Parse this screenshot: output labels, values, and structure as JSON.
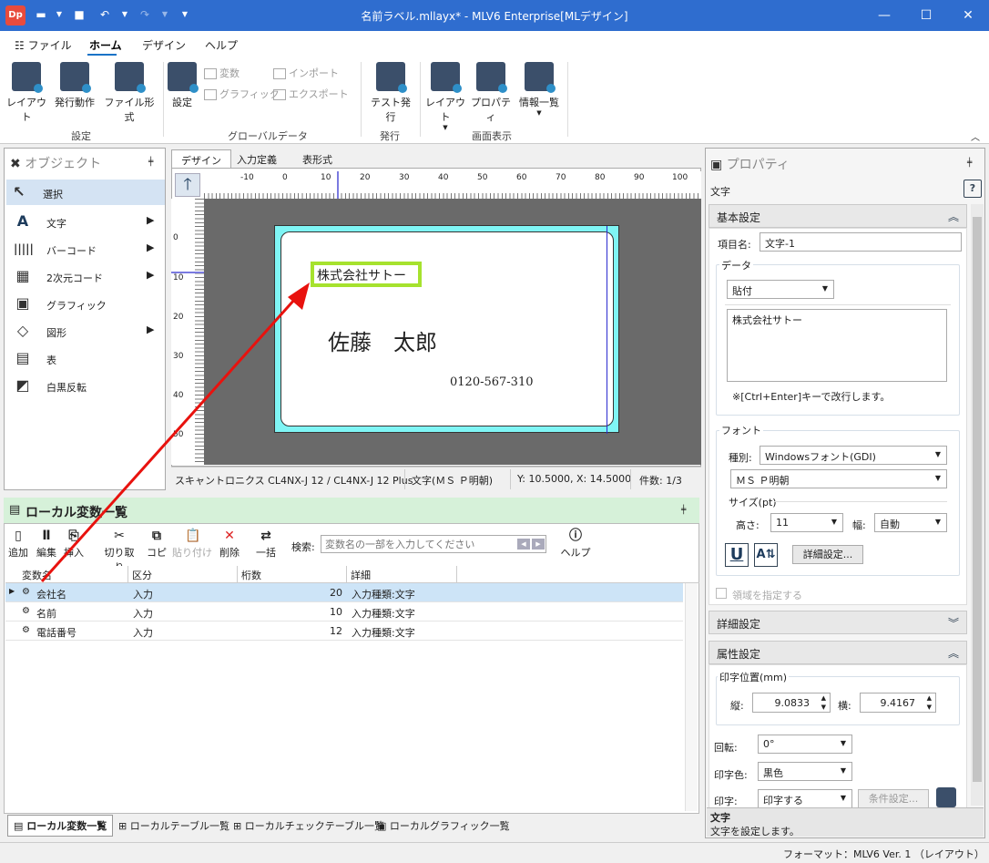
{
  "titlebar": {
    "title": "名前ラベル.mllayx* - MLV6 Enterprise[MLデザイン]",
    "app_icon": "Dp"
  },
  "menu": {
    "items": [
      "ファイル",
      "ホーム",
      "デザイン",
      "ヘルプ"
    ]
  },
  "ribbon": {
    "layout": "レイアウト",
    "issue_action": "発行動作",
    "file_format": "ファイル形式",
    "group_settings": "設定",
    "global_settings": "設定",
    "variable": "変数",
    "graphic": "グラフィック",
    "import": "インポート",
    "export": "エクスポート",
    "group_global": "グローバルデータ",
    "test_issue": "テスト発行",
    "group_issue": "発行",
    "view_layout": "レイアウト",
    "property": "プロパティ",
    "info_list": "情報一覧",
    "group_view": "画面表示"
  },
  "object_panel": {
    "title": "オブジェクト",
    "items": [
      {
        "label": "選択"
      },
      {
        "label": "文字"
      },
      {
        "label": "バーコード"
      },
      {
        "label": "2次元コード"
      },
      {
        "label": "グラフィック"
      },
      {
        "label": "図形"
      },
      {
        "label": "表"
      },
      {
        "label": "白黒反転"
      }
    ]
  },
  "design_tabs": [
    "デザイン",
    "入力定義",
    "表形式"
  ],
  "ruler": {
    "h": [
      "-10",
      "0",
      "10",
      "20",
      "30",
      "40",
      "50",
      "60",
      "70",
      "80",
      "90",
      "100"
    ],
    "v": [
      "0",
      "10",
      "20",
      "30",
      "40",
      "50"
    ]
  },
  "label": {
    "company": "株式会社サトー",
    "name": "佐藤　太郎",
    "phone": "0120-567-310"
  },
  "canvas_status": {
    "printer": "スキャントロニクス CL4NX-J 12 / CL4NX-J 12 Plus",
    "font": "文字(ＭＳ Ｐ明朝)",
    "pos": "Y: 10.5000, X: 14.5000",
    "count": "件数: 1/3"
  },
  "local_vars": {
    "title": "ローカル変数一覧",
    "toolbar": {
      "add": "追加",
      "edit": "編集",
      "insert": "挿入",
      "cut": "切り取り",
      "copy": "コピー",
      "paste": "貼り付け",
      "delete": "削除",
      "batch": "一括",
      "search_label": "検索:",
      "search_placeholder": "変数名の一部を入力してください",
      "help": "ヘルプ"
    },
    "columns": [
      "変数名",
      "区分",
      "桁数",
      "詳細"
    ],
    "rows": [
      {
        "name": "会社名",
        "kind": "入力",
        "digits": "20",
        "detail": "入力種類:文字"
      },
      {
        "name": "名前",
        "kind": "入力",
        "digits": "10",
        "detail": "入力種類:文字"
      },
      {
        "name": "電話番号",
        "kind": "入力",
        "digits": "12",
        "detail": "入力種類:文字"
      }
    ]
  },
  "bottom_tabs": [
    "ローカル変数一覧",
    "ローカルテーブル一覧",
    "ローカルチェックテーブル一覧",
    "ローカルグラフィック一覧"
  ],
  "properties": {
    "title": "プロパティ",
    "subtitle": "文字",
    "basic": "基本設定",
    "item_name_label": "項目名:",
    "item_name": "文字-1",
    "data_label": "データ",
    "data_type": "貼付",
    "data_value": "株式会社サトー",
    "data_hint": "※[Ctrl+Enter]キーで改行します。",
    "font_label": "フォント",
    "kind_label": "種別:",
    "font_kind": "Windowsフォント(GDI)",
    "font_name": "ＭＳ Ｐ明朝",
    "size_label": "サイズ(pt)",
    "height_label": "高さ:",
    "height": "11",
    "width_label": "幅:",
    "width": "自動",
    "detail_btn": "詳細設定...",
    "region_label": "領域を指定する",
    "advanced": "詳細設定",
    "attr": "属性設定",
    "print_pos": "印字位置(mm)",
    "v_label": "縦:",
    "v_val": "9.0833",
    "h_label": "横:",
    "h_val": "9.4167",
    "rotate_label": "回転:",
    "rotate": "0°",
    "color_label": "印字色:",
    "color": "黒色",
    "print_label": "印字:",
    "print": "印字する",
    "cond_btn": "条件設定...",
    "desc_title": "文字",
    "desc": "文字を設定します。"
  },
  "status": {
    "format": "フォーマット：MLV6 Ver. 1 （レイアウト）"
  },
  "colors": {
    "titlebar": "#2f6dcf",
    "accent": "#1a73c7",
    "selection_border": "#a6e22e",
    "label_bg": "#7ff5f5",
    "arrow": "#e8120e"
  }
}
